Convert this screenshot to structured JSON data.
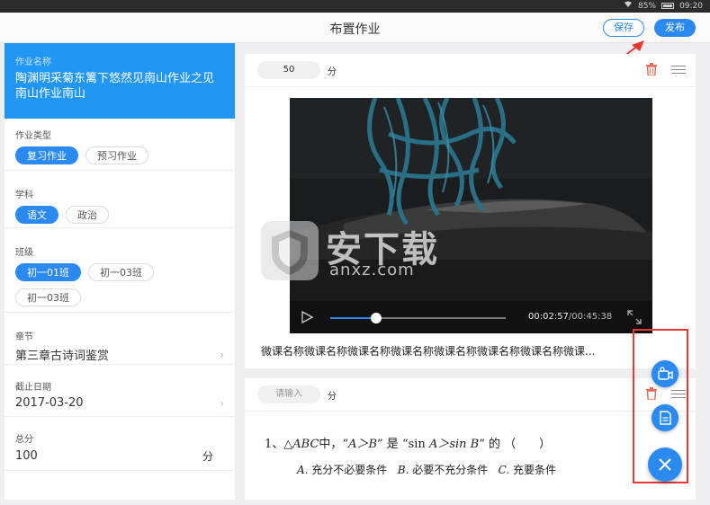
{
  "status_bar": {
    "battery": "85%",
    "time": "09:20"
  },
  "header": {
    "title": "布置作业",
    "save_label": "保存",
    "publish_label": "发布"
  },
  "left_panel": {
    "name_label": "作业名称",
    "name_value": "陶渊明采菊东篱下悠然见南山作业之见南山作业南山",
    "type_label": "作业类型",
    "types": [
      {
        "label": "复习作业",
        "active": true
      },
      {
        "label": "预习作业",
        "active": false
      }
    ],
    "subject_label": "学科",
    "subjects": [
      {
        "label": "语文",
        "active": true
      },
      {
        "label": "政治",
        "active": false
      }
    ],
    "class_label": "班级",
    "classes": [
      {
        "label": "初一01班",
        "active": true
      },
      {
        "label": "初一03班",
        "active": false
      },
      {
        "label": "初一03班",
        "active": false
      }
    ],
    "chapter_label": "章节",
    "chapter_value": "第三章古诗词鉴赏",
    "deadline_label": "截止日期",
    "deadline_value": "2017-03-20",
    "total_label": "总分",
    "total_value": "100",
    "total_unit": "分"
  },
  "card1": {
    "score": "50",
    "score_unit": "分",
    "time_current": "00:02:57",
    "time_total": "/00:45:38",
    "progress_fraction": 0.26,
    "caption": "微课名称微课名称微课名称微课名称微课名称微课名称微课名称微课..."
  },
  "card2": {
    "score_placeholder": "请输入",
    "score_unit": "分",
    "question_prefix": "1、△",
    "question_abc": "ABC",
    "question_mid": "中，“",
    "question_ab": "A＞B",
    "question_mid2": "” 是 “sin ",
    "question_sin": "A＞sin B",
    "question_end": "” 的 （　　）",
    "opt_a_letter": "A.",
    "opt_a": " 充分不必要条件   ",
    "opt_b_letter": "B.",
    "opt_b": " 必要不充分条件   ",
    "opt_c_letter": "C.",
    "opt_c": " 充要条件"
  },
  "watermark": {
    "text": "安下载",
    "url": "anxz.com"
  },
  "colors": {
    "accent": "#2a8af0",
    "highlight": "#e53935",
    "name_bg": "#2196f3"
  },
  "icons": {
    "delete": "trash-icon",
    "drag": "menu-icon",
    "play": "play-icon",
    "fullscreen": "fullscreen-icon",
    "video_add": "video-camera-icon",
    "doc_add": "document-icon",
    "close": "close-icon"
  }
}
